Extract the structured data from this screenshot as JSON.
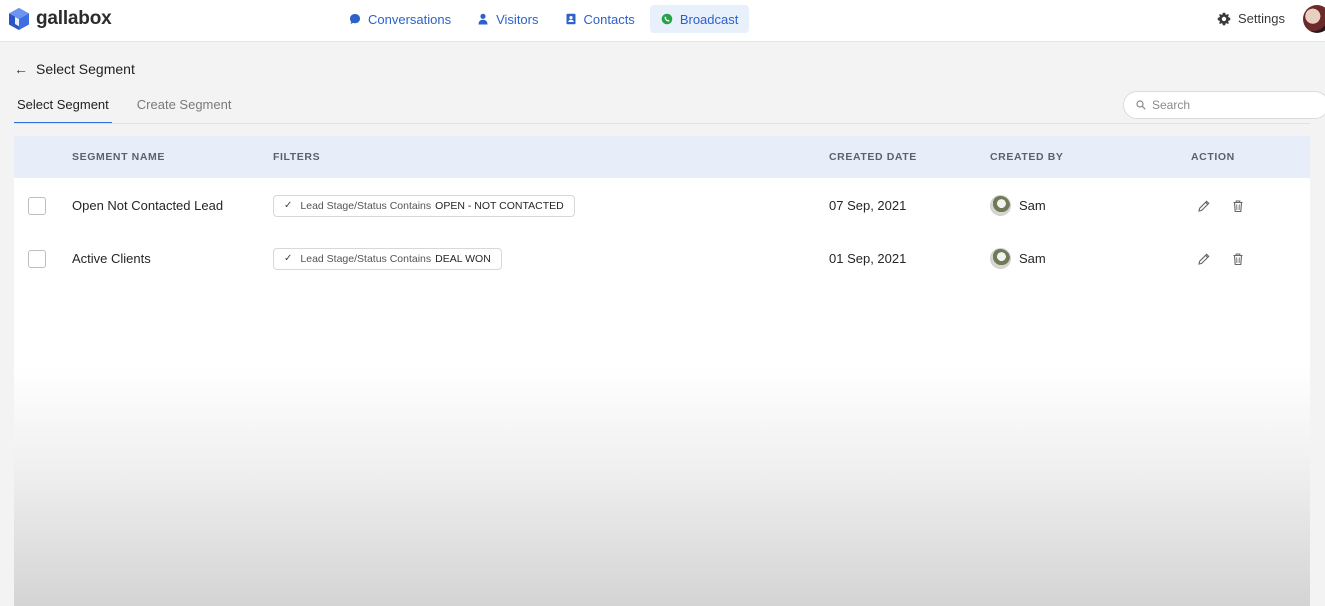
{
  "brand": {
    "name": "gallabox"
  },
  "nav": {
    "items": [
      {
        "label": "Conversations",
        "icon": "chat-bubble-icon"
      },
      {
        "label": "Visitors",
        "icon": "person-icon"
      },
      {
        "label": "Contacts",
        "icon": "address-book-icon"
      },
      {
        "label": "Broadcast",
        "icon": "whatsapp-icon",
        "active": true
      }
    ],
    "settings_label": "Settings"
  },
  "page": {
    "title": "Select Segment",
    "tabs": [
      {
        "label": "Select Segment",
        "active": true
      },
      {
        "label": "Create Segment",
        "active": false
      }
    ],
    "search_placeholder": "Search"
  },
  "table": {
    "columns": {
      "segment_name": "SEGMENT NAME",
      "filters": "FILTERS",
      "created_date": "CREATED DATE",
      "created_by": "CREATED BY",
      "action": "ACTION"
    },
    "rows": [
      {
        "segment_name": "Open Not Contacted Lead",
        "filter_field": "Lead Stage/Status Contains",
        "filter_value": "OPEN - NOT CONTACTED",
        "created_date": "07 Sep, 2021",
        "created_by": "Sam"
      },
      {
        "segment_name": "Active Clients",
        "filter_field": "Lead Stage/Status Contains",
        "filter_value": "DEAL WON",
        "created_date": "01 Sep, 2021",
        "created_by": "Sam"
      }
    ]
  },
  "colors": {
    "accent": "#2d6de0",
    "nav_text": "#2c62c9",
    "broadcast_icon": "#25a244",
    "table_header_bg": "#e7eef9"
  }
}
